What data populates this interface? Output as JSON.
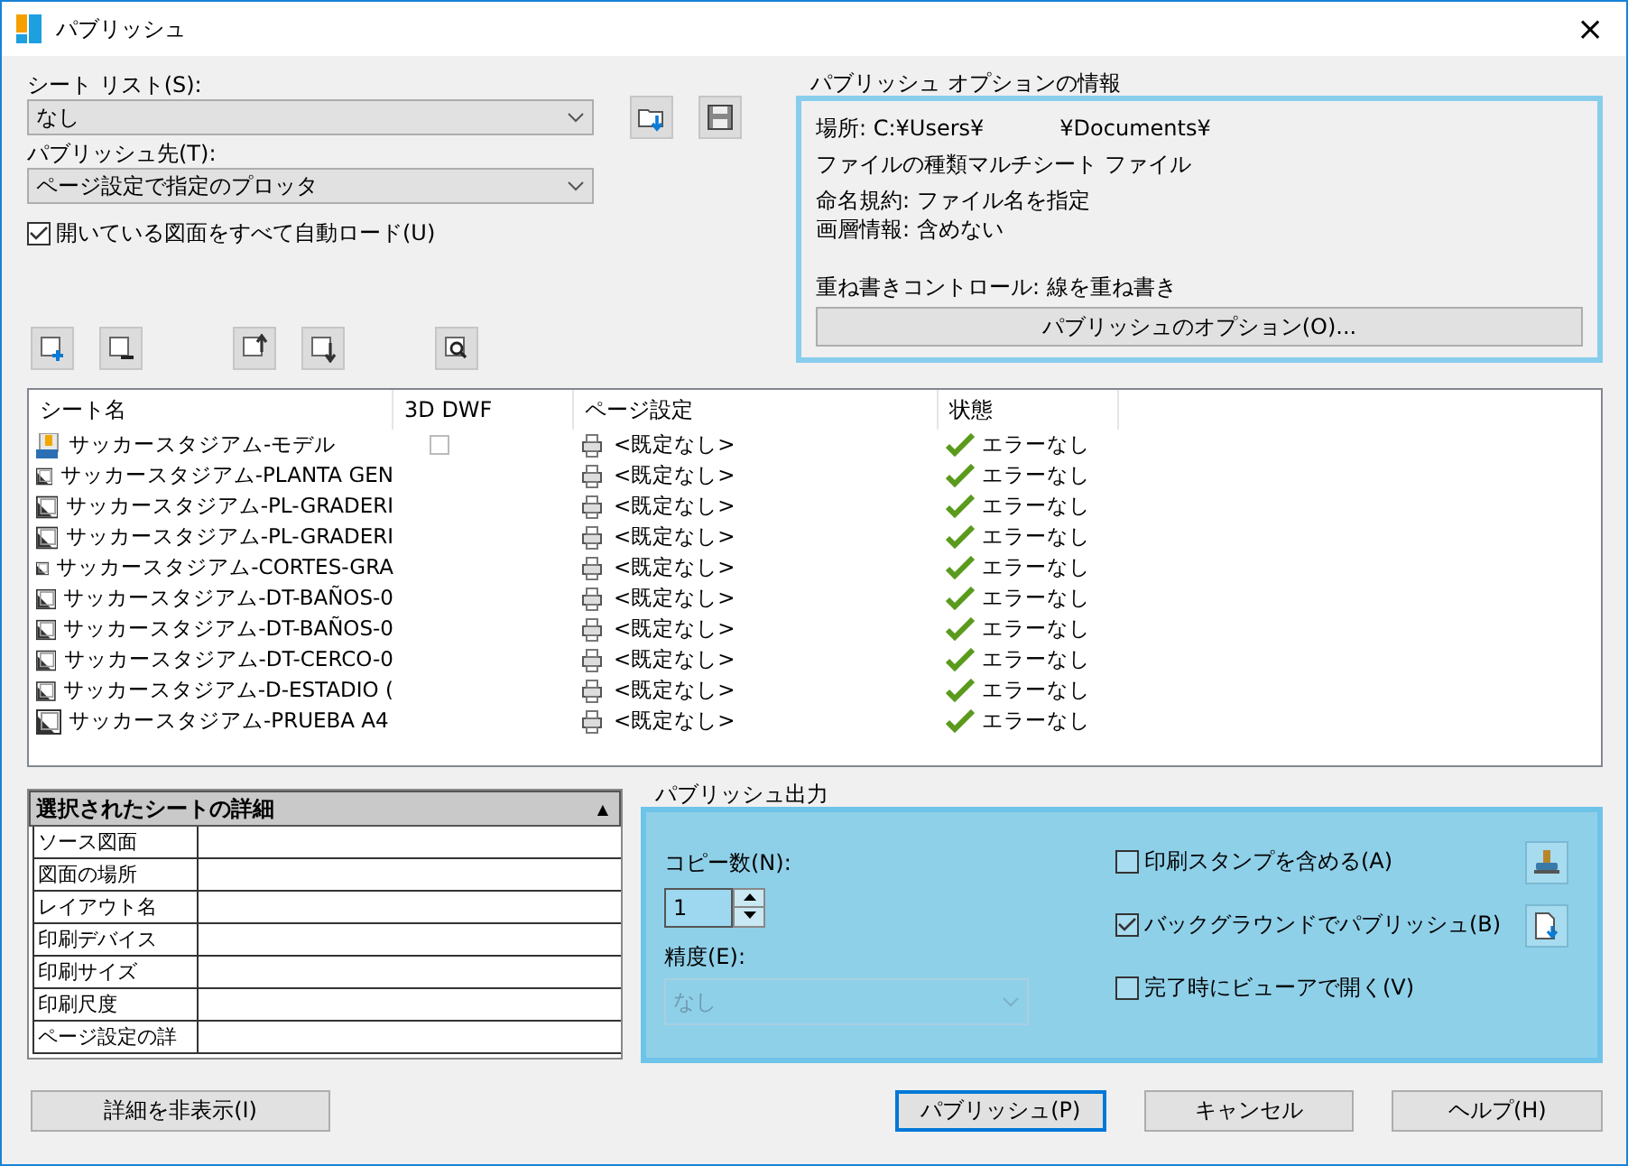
{
  "window": {
    "title": "パブリッシュ",
    "close": "×"
  },
  "sheet_list": {
    "label": "シート リスト(S):",
    "value": "なし"
  },
  "publish_to": {
    "label": "パブリッシュ先(T):",
    "value": "ページ設定で指定のプロッタ"
  },
  "auto_load": {
    "label": "開いている図面をすべて自動ロード(U)",
    "checked": true
  },
  "options_info": {
    "title": "パブリッシュ オプションの情報",
    "lines": [
      {
        "parts": [
          "場所: C:¥Users¥",
          "¥Documents¥"
        ]
      },
      {
        "parts": [
          "ファイルの種類マルチシート ファイル"
        ]
      },
      {
        "parts": [
          "命名規約:",
          "ファイル名を指定"
        ]
      },
      {
        "parts": [
          "画層情報:",
          "含めない"
        ]
      },
      {
        "parts": [
          "重ね書きコントロール: 線を重ね書き"
        ]
      }
    ],
    "button": "パブリッシュのオプション(O)..."
  },
  "table": {
    "columns": [
      "シート名",
      "3D DWF",
      "ページ設定",
      "状態"
    ],
    "rows": [
      {
        "kind": "model",
        "name": "サッカースタジアム-モデル",
        "dwf_checked": false,
        "page_setup": "<既定なし>",
        "status": "エラーなし"
      },
      {
        "kind": "layout",
        "name": "サッカースタジアム-PLANTA GEN",
        "page_setup": "<既定なし>",
        "status": "エラーなし"
      },
      {
        "kind": "layout",
        "name": "サッカースタジアム-PL-GRADERI",
        "page_setup": "<既定なし>",
        "status": "エラーなし"
      },
      {
        "kind": "layout",
        "name": "サッカースタジアム-PL-GRADERI",
        "page_setup": "<既定なし>",
        "status": "エラーなし"
      },
      {
        "kind": "layout",
        "name": "サッカースタジアム-CORTES-GRA",
        "page_setup": "<既定なし>",
        "status": "エラーなし"
      },
      {
        "kind": "layout",
        "name": "サッカースタジアム-DT-BAÑOS-0",
        "page_setup": "<既定なし>",
        "status": "エラーなし"
      },
      {
        "kind": "layout",
        "name": "サッカースタジアム-DT-BAÑOS-0",
        "page_setup": "<既定なし>",
        "status": "エラーなし"
      },
      {
        "kind": "layout",
        "name": "サッカースタジアム-DT-CERCO-0",
        "page_setup": "<既定なし>",
        "status": "エラーなし"
      },
      {
        "kind": "layout",
        "name": "サッカースタジアム-D-ESTADIO (",
        "page_setup": "<既定なし>",
        "status": "エラーなし"
      },
      {
        "kind": "layout",
        "name": "サッカースタジアム-PRUEBA A4",
        "page_setup": "<既定なし>",
        "status": "エラーなし"
      }
    ]
  },
  "details": {
    "title": "選択されたシートの詳細",
    "toggle": "▲",
    "rows": [
      "ソース図面",
      "図面の場所",
      "レイアウト名",
      "印刷デバイス",
      "印刷サイズ",
      "印刷尺度",
      "ページ設定の詳"
    ]
  },
  "output": {
    "title": "パブリッシュ出力",
    "copies_label": "コピー数(N):",
    "copies": "1",
    "precision_label": "精度(E):",
    "precision": "なし",
    "precision_disabled": true,
    "options": [
      {
        "label": "印刷スタンプを含める(A)",
        "checked": false,
        "kind": "stamp"
      },
      {
        "label": "バックグラウンドでパブリッシュ(B)",
        "checked": true,
        "kind": "document"
      },
      {
        "label": "完了時にビューアで開く(V)",
        "checked": false,
        "kind": "plain"
      }
    ]
  },
  "hide_details": "詳細を非表示(I)",
  "buttons": [
    {
      "label": "パブリッシュ(P)",
      "default": true
    },
    {
      "label": "キャンセル",
      "default": false
    },
    {
      "label": "ヘルプ(H)",
      "default": false
    }
  ]
}
